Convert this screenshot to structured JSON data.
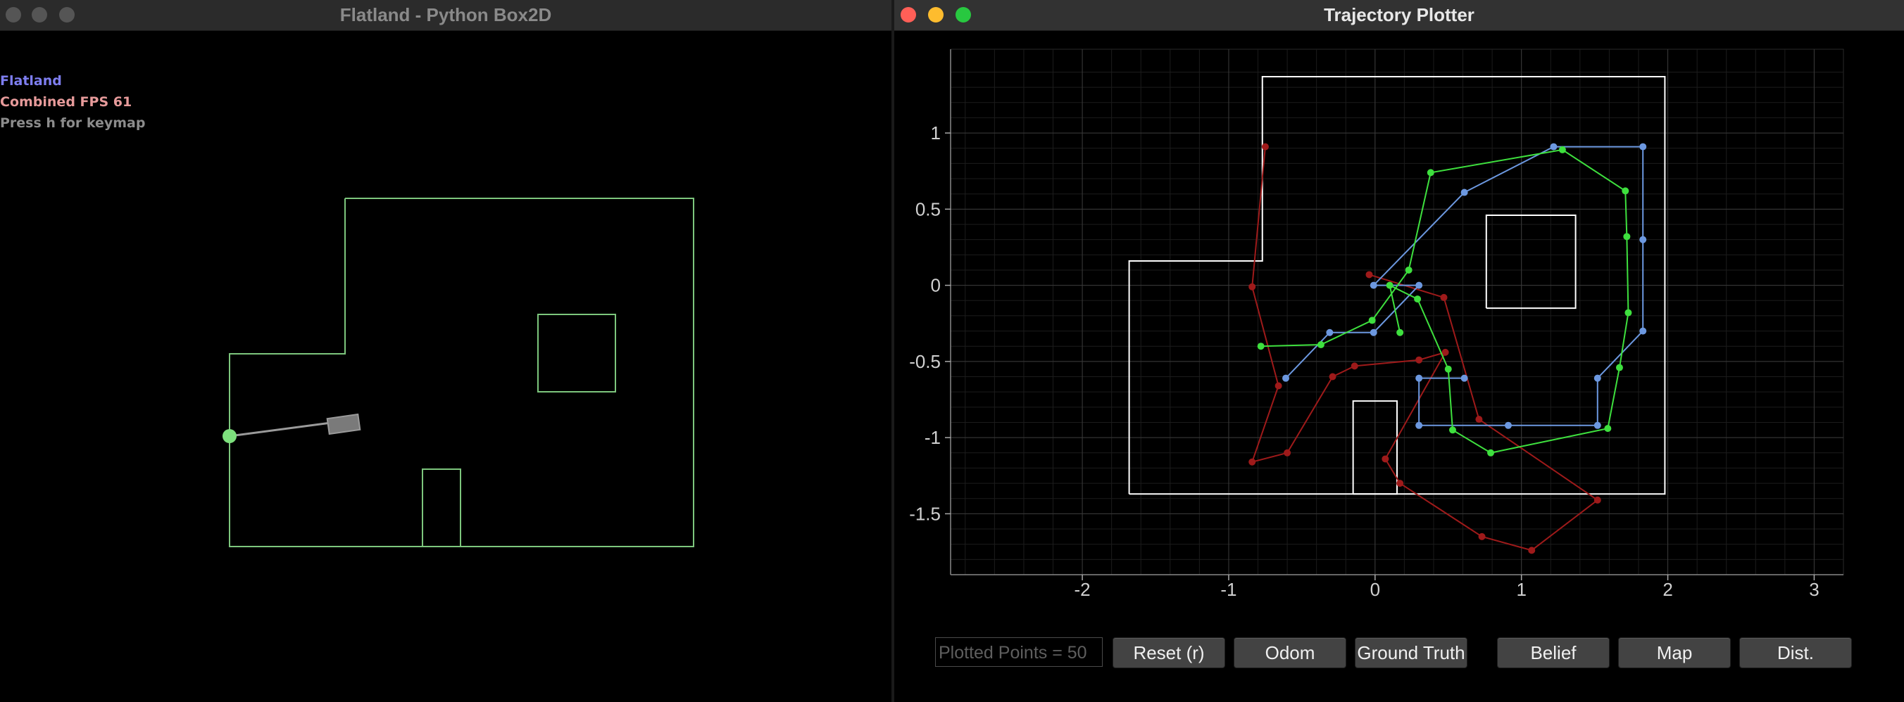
{
  "left_window": {
    "title": "Flatland - Python Box2D",
    "overlay": {
      "line1": "Flatland",
      "line2": "Combined FPS 61",
      "line3": "Press h for keymap"
    },
    "colors": {
      "line1": "#7e7ef0",
      "line2": "#e69a9a",
      "line3": "#8c8c8c",
      "walls": "#7dc67d",
      "robot": "#888888",
      "goal": "#7de07d"
    },
    "icons": [
      "close-icon",
      "minimize-icon",
      "zoom-icon"
    ]
  },
  "right_window": {
    "title": "Trajectory Plotter",
    "icons": [
      "close-icon",
      "minimize-icon",
      "zoom-icon"
    ],
    "status_text": "Plotted Points = 50",
    "buttons": {
      "reset": "Reset (r)",
      "odom": "Odom",
      "ground_truth": "Ground Truth",
      "belief": "Belief",
      "map": "Map",
      "dist": "Dist."
    }
  },
  "chart_data": {
    "type": "line",
    "title": "",
    "xlabel": "",
    "ylabel": "",
    "xlim": [
      -2.9,
      3.2
    ],
    "ylim": [
      -1.9,
      1.55
    ],
    "xticks": [
      "-2",
      "-1",
      "0",
      "1",
      "2",
      "3"
    ],
    "yticks": [
      "1",
      "0.5",
      "0",
      "-0.5",
      "-1",
      "-1.5"
    ],
    "xtick_values": [
      -2,
      -1,
      0,
      1,
      2,
      3
    ],
    "ytick_values": [
      1,
      0.5,
      0,
      -0.5,
      -1,
      -1.5
    ],
    "grid": true,
    "map_outline": [
      [
        -1.68,
        -1.37
      ],
      [
        1.98,
        -1.37
      ],
      [
        1.98,
        1.37
      ],
      [
        -0.77,
        1.37
      ],
      [
        -0.77,
        0.16
      ],
      [
        -1.68,
        0.16
      ],
      [
        -1.68,
        -1.37
      ]
    ],
    "map_obstacles": [
      [
        [
          0.76,
          -0.15
        ],
        [
          1.37,
          -0.15
        ],
        [
          1.37,
          0.46
        ],
        [
          0.76,
          0.46
        ],
        [
          0.76,
          -0.15
        ]
      ],
      [
        [
          -0.15,
          -1.37
        ],
        [
          0.15,
          -1.37
        ],
        [
          0.15,
          -0.76
        ],
        [
          -0.15,
          -0.76
        ],
        [
          -0.15,
          -1.37
        ]
      ]
    ],
    "series": [
      {
        "color": "#9e1a1a",
        "points": [
          [
            -0.75,
            0.91
          ],
          [
            -0.84,
            -0.01
          ],
          [
            -0.66,
            -0.66
          ],
          [
            -0.84,
            -1.16
          ],
          [
            -0.6,
            -1.1
          ],
          [
            -0.29,
            -0.6
          ],
          [
            -0.14,
            -0.53
          ],
          [
            0.3,
            -0.49
          ],
          [
            0.48,
            -0.44
          ],
          [
            0.07,
            -1.14
          ],
          [
            0.17,
            -1.3
          ],
          [
            0.73,
            -1.65
          ],
          [
            1.07,
            -1.74
          ],
          [
            1.52,
            -1.41
          ],
          [
            0.71,
            -0.88
          ],
          [
            0.47,
            -0.08
          ],
          [
            -0.04,
            0.07
          ]
        ]
      },
      {
        "color": "#6c98e0",
        "points": [
          [
            -0.61,
            -0.61
          ],
          [
            -0.31,
            -0.31
          ],
          [
            -0.01,
            -0.31
          ],
          [
            0.3,
            0.0
          ],
          [
            -0.01,
            0.0
          ],
          [
            0.61,
            0.61
          ],
          [
            1.22,
            0.91
          ],
          [
            1.83,
            0.91
          ],
          [
            1.83,
            0.3
          ],
          [
            1.83,
            -0.3
          ],
          [
            1.52,
            -0.61
          ],
          [
            1.52,
            -0.92
          ],
          [
            0.91,
            -0.92
          ],
          [
            0.3,
            -0.92
          ],
          [
            0.3,
            -0.61
          ],
          [
            0.61,
            -0.61
          ]
        ]
      },
      {
        "color": "#3ee03e",
        "points": [
          [
            -0.78,
            -0.4
          ],
          [
            -0.37,
            -0.39
          ],
          [
            -0.02,
            -0.23
          ],
          [
            0.23,
            0.1
          ],
          [
            0.38,
            0.74
          ],
          [
            1.28,
            0.89
          ],
          [
            1.71,
            0.62
          ],
          [
            1.72,
            0.32
          ],
          [
            1.73,
            -0.18
          ],
          [
            1.67,
            -0.54
          ],
          [
            1.59,
            -0.94
          ],
          [
            0.79,
            -1.1
          ],
          [
            0.53,
            -0.95
          ],
          [
            0.5,
            -0.55
          ],
          [
            0.29,
            -0.09
          ],
          [
            0.1,
            0.0
          ],
          [
            0.17,
            -0.31
          ]
        ]
      }
    ]
  }
}
